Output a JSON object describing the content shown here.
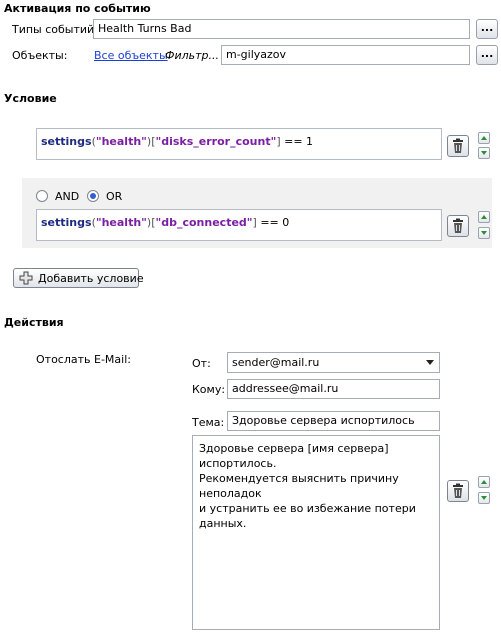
{
  "activation": {
    "header": "Активация по событию",
    "event_types_label": "Типы событий:",
    "event_types_value": "Health Turns Bad",
    "objects_label": "Объекты:",
    "all_objects_link": "Все объекты",
    "filter_label": "Фильтр...",
    "filter_value": "m-gilyazov",
    "ellipsis": "..."
  },
  "condition": {
    "header": "Условие",
    "items": [
      {
        "func": "settings",
        "arg1": "\"health\"",
        "arg2": "\"disks_error_count\"",
        "op": "== 1"
      },
      {
        "func": "settings",
        "arg1": "\"health\"",
        "arg2": "\"db_connected\"",
        "op": "== 0"
      }
    ],
    "and_label": "AND",
    "or_label": "OR",
    "logic_selected": "OR",
    "add_button_label": "Добавить условие"
  },
  "actions": {
    "header": "Действия",
    "send_email_label": "Отослать E-Mail:",
    "from_label": "От:",
    "from_value": "sender@mail.ru",
    "to_label": "Кому:",
    "to_value": "addressee@mail.ru",
    "subject_label": "Тема:",
    "subject_value": "Здоровье сервера испортилось",
    "body_lines": [
      "Здоровье сервера [имя сервера] испортилось.",
      "Рекомендуется выяснить причину неполадок",
      "и устранить ее во избежание потери данных."
    ]
  },
  "icons": {
    "delete": "trash-icon",
    "up": "arrow-up-icon",
    "down": "arrow-down-icon",
    "add": "plus-icon",
    "dropdown": "chevron-down-icon"
  },
  "colors": {
    "keyword": "#1e2a80",
    "string": "#7b1fa2",
    "link": "#1a3fd6",
    "panel_bg": "#f1f1f1"
  }
}
